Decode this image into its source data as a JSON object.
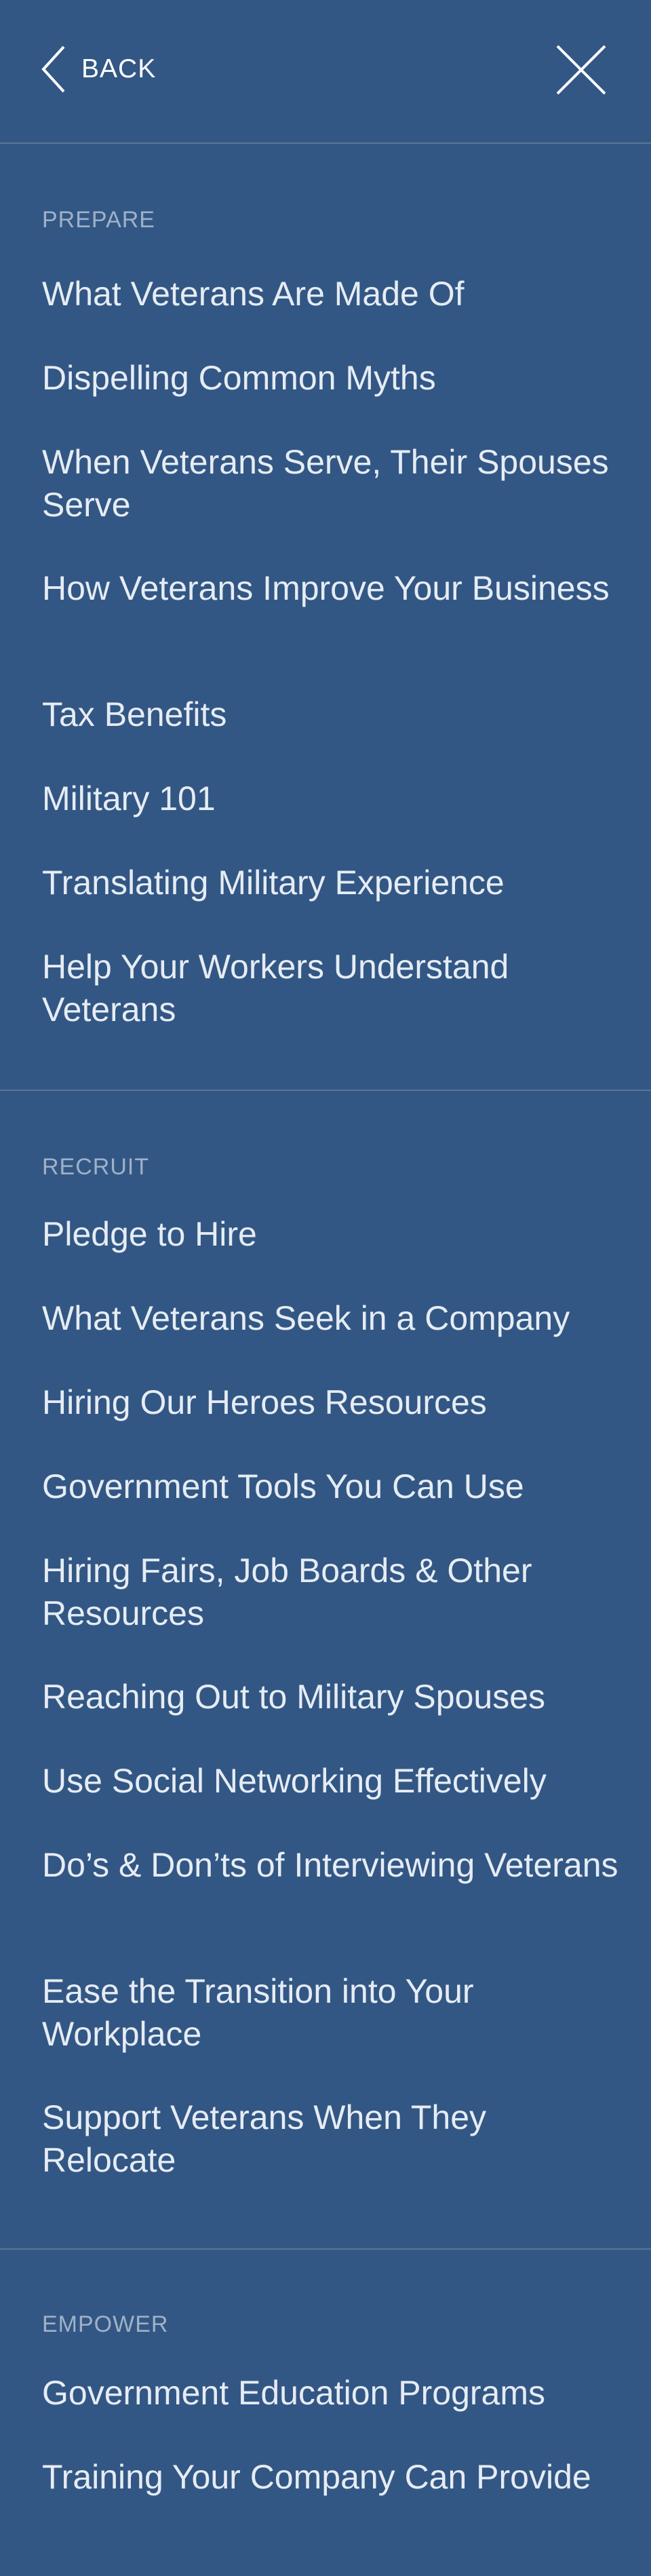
{
  "header": {
    "back_label": "BACK",
    "icons": {
      "back": "chevron-left-icon",
      "close": "close-icon"
    }
  },
  "sections": [
    {
      "title": "PREPARE",
      "items": [
        "What Veterans Are Made Of",
        "Dispelling Common Myths",
        "When Veterans Serve, Their Spouses Serve",
        "How Veterans Improve Your Business",
        "Tax Benefits",
        "Military 101",
        "Translating Military Experience",
        "Help Your Workers Understand Veterans"
      ]
    },
    {
      "title": "RECRUIT",
      "items": [
        "Pledge to Hire",
        "What Veterans Seek in a Company",
        "Hiring Our Heroes Resources",
        "Government Tools You Can Use",
        "Hiring Fairs, Job Boards & Other Resources",
        "Reaching Out to Military Spouses",
        "Use Social Networking Effectively",
        "Do’s & Don’ts of Interviewing Veterans",
        "Ease the Transition into Your Workplace",
        "Support Veterans When They Relocate"
      ]
    },
    {
      "title": "EMPOWER",
      "items": [
        "Government Education Programs",
        "Training Your Company Can Provide"
      ]
    }
  ],
  "colors": {
    "background": "#335784",
    "divider": "#5a7599",
    "section_title": "#9fb1c8",
    "item_text": "#e6ecf4"
  }
}
